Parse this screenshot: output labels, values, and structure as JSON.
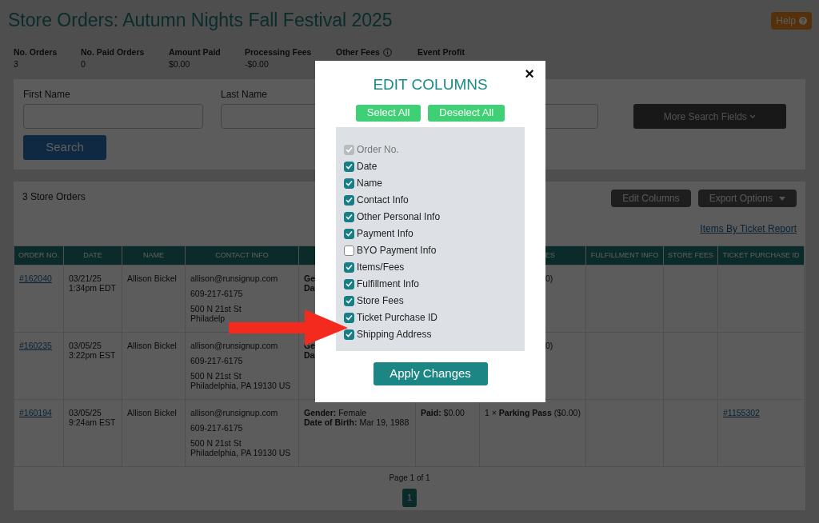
{
  "page": {
    "title": "Store Orders: Autumn Nights Fall Festival 2025",
    "help_button": "Help"
  },
  "stats": [
    {
      "label": "No. Orders",
      "value": "3"
    },
    {
      "label": "No. Paid Orders",
      "value": "0"
    },
    {
      "label": "Amount Paid",
      "value": "$0.00"
    },
    {
      "label": "Processing Fees",
      "value": "-$0.00"
    },
    {
      "label": "Other Fees",
      "kind": "info"
    },
    {
      "label": "Event Profit"
    }
  ],
  "search": {
    "fields": [
      {
        "label": "First Name"
      },
      {
        "label": "Last Name"
      }
    ],
    "third_field": true,
    "more_button": "More Search Fields",
    "search_button": "Search"
  },
  "orders": {
    "heading": "3 Store Orders",
    "buttons": [
      {
        "label": "Edit Columns",
        "kind": "plain"
      },
      {
        "label": "Export Options",
        "kind": "dropdown"
      }
    ],
    "report_link": "Items By Ticket Report",
    "columns": [
      {
        "label": "ORDER NO."
      },
      {
        "label": "DATE"
      },
      {
        "label": "NAME"
      },
      {
        "label": "CONTACT INFO"
      },
      {},
      {},
      {
        "label": "ES",
        "kind": "covered"
      },
      {
        "label": "FULFILLMENT INFO"
      },
      {
        "label": "STORE FEES"
      },
      {
        "label": "TICKET PURCHASE ID"
      }
    ],
    "rows": [
      {
        "cells": [
          {
            "kind": "link",
            "paragraphs": [
              [
                "#162040"
              ]
            ]
          },
          {
            "paragraphs": [
              [
                "03/21/25",
                "1:34pm EDT"
              ]
            ]
          },
          {
            "paragraphs": [
              [
                "Allison Bickel"
              ]
            ]
          },
          {
            "paragraphs": [
              [
                "allison@runsignup.com"
              ],
              [
                "609-217-6175"
              ],
              [
                "500 N 21st St",
                "Philadelp"
              ]
            ]
          },
          {
            "paragraphs": [
              [
                "**Ge**",
                "**Da**"
              ]
            ]
          },
          {},
          {
            "kind": "covered",
            "paragraphs": [
              [
                "0)"
              ]
            ]
          },
          {},
          {},
          {}
        ]
      },
      {
        "cells": [
          {
            "kind": "link",
            "paragraphs": [
              [
                "#160235"
              ]
            ]
          },
          {
            "paragraphs": [
              [
                "03/05/25",
                "3:22pm EST"
              ]
            ]
          },
          {
            "paragraphs": [
              [
                "Allison Bickel"
              ]
            ]
          },
          {
            "paragraphs": [
              [
                "allison@runsignup.com"
              ],
              [
                "609-217-6175"
              ],
              [
                "500 N 21st St",
                "Philadelphia, PA 19130 US"
              ]
            ]
          },
          {
            "paragraphs": [
              [
                "**Ge**",
                "**Da**"
              ]
            ]
          },
          {},
          {
            "kind": "covered",
            "paragraphs": [
              [
                "0)"
              ]
            ]
          },
          {},
          {},
          {}
        ]
      },
      {
        "cells": [
          {
            "kind": "link",
            "paragraphs": [
              [
                "#160194"
              ]
            ]
          },
          {
            "paragraphs": [
              [
                "03/05/25",
                "9:24am EST"
              ]
            ]
          },
          {
            "paragraphs": [
              [
                "Allison Bickel"
              ]
            ]
          },
          {
            "paragraphs": [
              [
                "allison@runsignup.com"
              ],
              [
                "609-217-6175"
              ],
              [
                "500 N 21st St",
                "Philadelphia, PA 19130 US"
              ]
            ]
          },
          {
            "paragraphs": [
              [
                "**Gender:** Female",
                "**Date of Birth:** Mar 19, 1988"
              ]
            ]
          },
          {
            "paragraphs": [
              [
                "**Paid:** $0.00"
              ]
            ]
          },
          {
            "paragraphs": [
              [
                "1 × **Parking Pass** ($0.00)"
              ]
            ]
          },
          {},
          {},
          {
            "kind": "link",
            "paragraphs": [
              [
                "#1155302"
              ]
            ]
          }
        ]
      }
    ],
    "pagination": {
      "label": "Page 1 of 1",
      "pages": [
        {
          "label": "1",
          "selected": true
        }
      ]
    }
  },
  "modal": {
    "title": "EDIT COLUMNS",
    "close": "×",
    "select_all": "Select All",
    "deselect_all": "Deselect All",
    "columns": [
      {
        "label": "Order No.",
        "checked": true,
        "disabled": true
      },
      {
        "label": "Date",
        "checked": true,
        "disabled": false
      },
      {
        "label": "Name",
        "checked": true,
        "disabled": false
      },
      {
        "label": "Contact Info",
        "checked": true,
        "disabled": false
      },
      {
        "label": "Other Personal Info",
        "checked": true,
        "disabled": false
      },
      {
        "label": "Payment Info",
        "checked": true,
        "disabled": false
      },
      {
        "label": "BYO Payment Info",
        "checked": false,
        "disabled": false
      },
      {
        "label": "Items/Fees",
        "checked": true,
        "disabled": false
      },
      {
        "label": "Fulfillment Info",
        "checked": true,
        "disabled": false
      },
      {
        "label": "Store Fees",
        "checked": true,
        "disabled": false
      },
      {
        "label": "Ticket Purchase ID",
        "checked": true,
        "disabled": false
      },
      {
        "label": "Shipping Address",
        "checked": true,
        "disabled": false
      }
    ],
    "apply_button": "Apply Changes"
  }
}
